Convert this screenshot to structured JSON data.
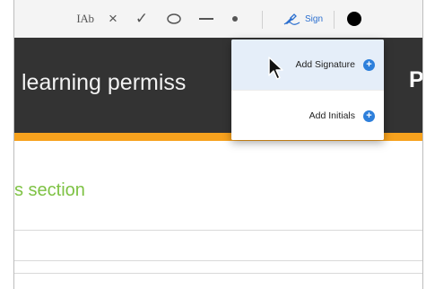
{
  "toolbar": {
    "text_tool_label": "IAb",
    "cross_icon": "×",
    "check_icon": "✓",
    "circle_icon": "circle-icon",
    "line_icon": "line-icon",
    "dot_icon": "dot-icon",
    "sign_label": "Sign",
    "color_swatch": "#000000"
  },
  "banner": {
    "title": "learning permiss",
    "title_right": "Proje",
    "background": "#333333",
    "accent": "#f7a21e"
  },
  "content": {
    "section_heading": "s section",
    "heading_color": "#7ec244"
  },
  "sign_menu": {
    "items": [
      {
        "label": "Add Signature",
        "icon": "plus-circle-icon",
        "highlighted": true
      },
      {
        "label": "Add Initials",
        "icon": "plus-circle-icon",
        "highlighted": false
      }
    ],
    "accent": "#2d7fdb"
  }
}
